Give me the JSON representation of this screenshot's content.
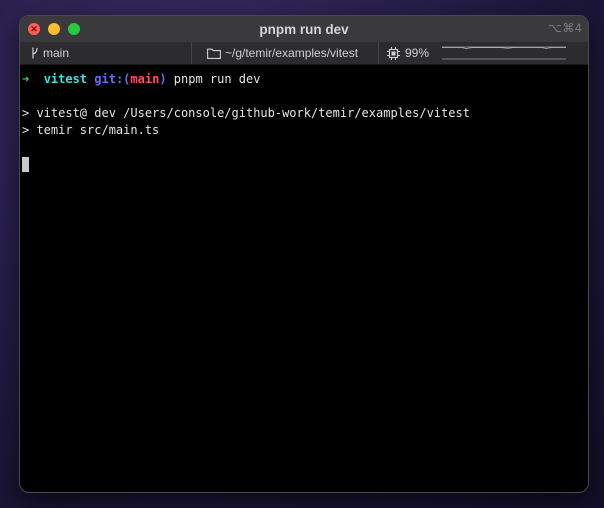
{
  "window": {
    "title": "pnpm run dev",
    "shortcut": "⌥⌘4"
  },
  "statusbar": {
    "branch_icon": "git-branch-icon",
    "branch": "main",
    "folder_icon": "folder-icon",
    "path": "~/g/temir/examples/vitest",
    "cpu_icon": "cpu-chip-icon",
    "cpu": "99%"
  },
  "terminal": {
    "prompt_arrow": "➜",
    "prompt_dir": "vitest",
    "git_prefix": "git:(",
    "git_branch": "main",
    "git_suffix": ")",
    "command": "pnpm run dev",
    "output": [
      "> vitest@ dev /Users/console/github-work/temir/examples/vitest",
      "> temir src/main.ts"
    ]
  },
  "colors": {
    "prompt_arrow": "#2fd86b",
    "prompt_dir": "#3ee0e0",
    "git_label": "#6a6cf0",
    "git_branch": "#ff4d5e",
    "close": "#ff5f57",
    "minimize": "#febc2e",
    "zoom": "#28c840"
  }
}
